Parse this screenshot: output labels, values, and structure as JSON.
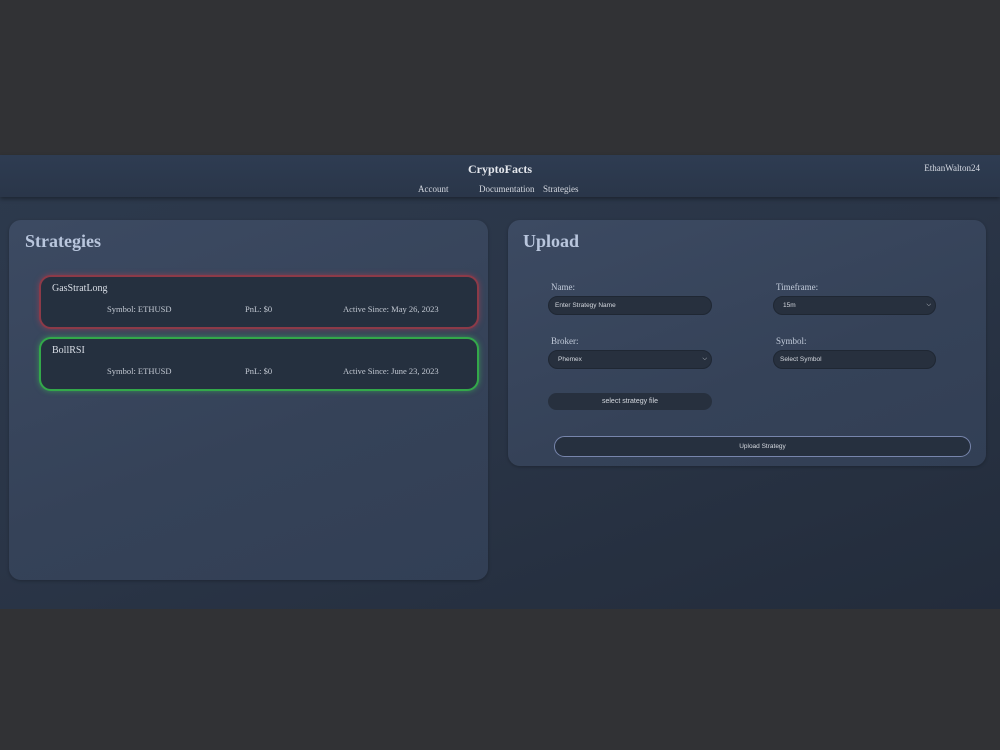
{
  "header": {
    "brand": "CryptoFacts",
    "user": "EthanWalton24",
    "nav": [
      {
        "label": "Account"
      },
      {
        "label": "Documentation"
      },
      {
        "label": "Strategies"
      }
    ]
  },
  "strategies": {
    "title": "Strategies",
    "items": [
      {
        "name": "GasStratLong",
        "symbol": "Symbol: ETHUSD",
        "pnl": "PnL: $0",
        "active": "Active Since: May 26, 2023",
        "status_color": "#8c3a48"
      },
      {
        "name": "BollRSI",
        "symbol": "Symbol: ETHUSD",
        "pnl": "PnL: $0",
        "active": "Active Since: June 23, 2023",
        "status_color": "#33a84a"
      }
    ]
  },
  "upload": {
    "title": "Upload",
    "name_label": "Name:",
    "name_placeholder": "Enter Strategy Name",
    "timeframe_label": "Timeframe:",
    "timeframe_value": "15m",
    "broker_label": "Broker:",
    "broker_value": "Phemex",
    "symbol_label": "Symbol:",
    "symbol_placeholder": "Select Symbol",
    "file_button": "select strategy file",
    "upload_button": "Upload Strategy"
  }
}
